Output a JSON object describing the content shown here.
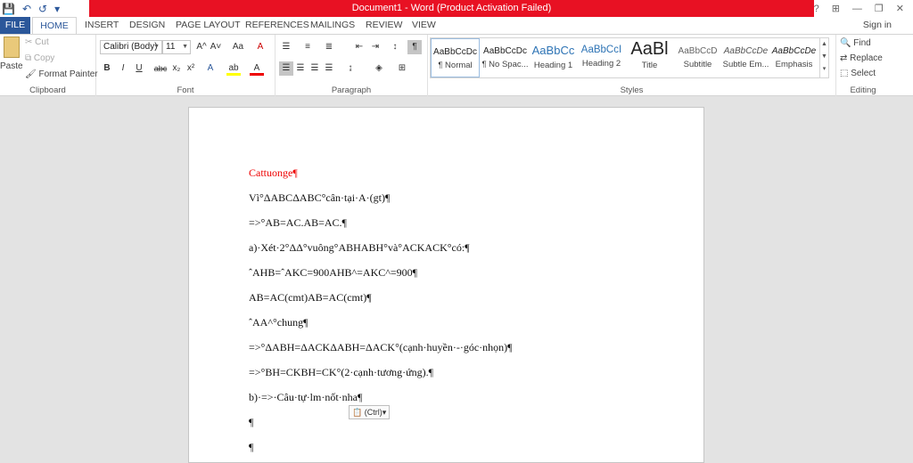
{
  "window": {
    "title": "Document1 -  Word (Product Activation Failed)",
    "help": "?",
    "minimize": "—",
    "restore": "❐",
    "close": "✕",
    "ribbon_options": "⊞"
  },
  "qat": {
    "save": "💾",
    "undo": "↶",
    "redo": "↺",
    "customize": "▾"
  },
  "tabs": [
    "FILE",
    "HOME",
    "INSERT",
    "DESIGN",
    "PAGE LAYOUT",
    "REFERENCES",
    "MAILINGS",
    "REVIEW",
    "VIEW"
  ],
  "signin": "Sign in",
  "clipboard": {
    "paste": "Paste",
    "cut": "Cut",
    "copy": "Copy",
    "format_painter": "Format Painter",
    "label": "Clipboard"
  },
  "font": {
    "name": "Calibri (Body)",
    "size": "11",
    "label": "Font",
    "bold": "B",
    "italic": "I",
    "underline": "U",
    "strike": "abc",
    "sub": "x₂",
    "sup": "x²",
    "grow": "A^",
    "shrink": "A˅",
    "case": "Aa",
    "clear": "A",
    "effects": "A",
    "highlight": "ab",
    "color": "A"
  },
  "paragraph": {
    "label": "Paragraph",
    "pilcrow": "¶"
  },
  "styles": {
    "label": "Styles",
    "items": [
      {
        "preview": "AaBbCcDc",
        "name": "¶ Normal"
      },
      {
        "preview": "AaBbCcDc",
        "name": "¶ No Spac..."
      },
      {
        "preview": "AaBbCc",
        "name": "Heading 1"
      },
      {
        "preview": "AaBbCcI",
        "name": "Heading 2"
      },
      {
        "preview": "AaBl",
        "name": "Title"
      },
      {
        "preview": "AaBbCcD",
        "name": "Subtitle"
      },
      {
        "preview": "AaBbCcDe",
        "name": "Subtle Em..."
      },
      {
        "preview": "AaBbCcDe",
        "name": "Emphasis"
      }
    ]
  },
  "editing": {
    "find": "Find",
    "replace": "Replace",
    "select": "Select",
    "label": "Editing"
  },
  "document": {
    "lines": [
      "Cattuonge¶",
      "Vì°ΔABCΔABC°cân·tại·A·(gt)¶",
      "=>°AB=AC.AB=AC.¶",
      "a)·Xét·2°ΔΔ°vuông°ABHABH°và°ACKACK°có:¶",
      "ˆAHB=ˆAKC=900AHB^=AKC^=900¶",
      "AB=AC(cmt)AB=AC(cmt)¶",
      "ˆAA^°chung¶",
      "=>°ΔABH=ΔACKΔABH=ΔACK°(cạnh·huyền·-·góc·nhọn)¶",
      "=>°BH=CKBH=CK°(2·cạnh·tương·ứng).¶",
      "b)·=>·Câu·tự·lm·nốt·nha¶",
      "¶",
      "¶"
    ],
    "paste_options": "(Ctrl)▾"
  }
}
